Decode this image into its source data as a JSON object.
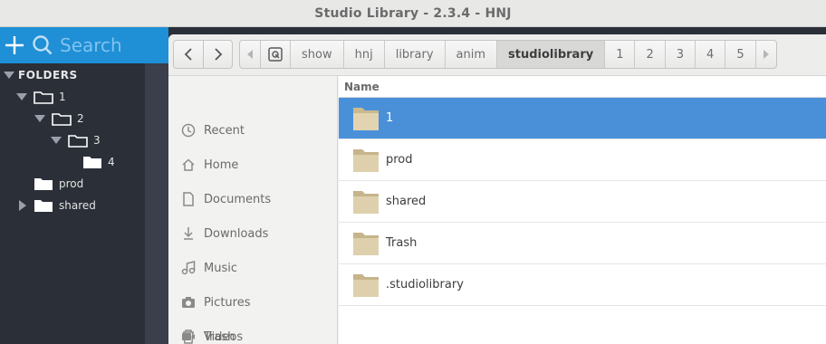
{
  "window": {
    "title": "Studio Library - 2.3.4 - HNJ"
  },
  "library": {
    "search_label": "Search",
    "folders_header": "FOLDERS",
    "tree": [
      {
        "label": "1",
        "level": 1,
        "expanded": true
      },
      {
        "label": "2",
        "level": 2,
        "expanded": true
      },
      {
        "label": "3",
        "level": 3,
        "expanded": true
      },
      {
        "label": "4",
        "level": 4,
        "expanded": false
      },
      {
        "label": "prod",
        "level": 1,
        "expanded": false
      },
      {
        "label": "shared",
        "level": 1,
        "expanded": false
      }
    ]
  },
  "dialog": {
    "breadcrumbs": [
      "show",
      "hnj",
      "library",
      "anim",
      "studiolibrary",
      "1",
      "2",
      "3",
      "4",
      "5"
    ],
    "active_crumb": "studiolibrary",
    "places": [
      {
        "label": "Recent",
        "icon": "clock-icon"
      },
      {
        "label": "Home",
        "icon": "home-icon"
      },
      {
        "label": "Documents",
        "icon": "document-icon"
      },
      {
        "label": "Downloads",
        "icon": "download-icon"
      },
      {
        "label": "Music",
        "icon": "music-icon"
      },
      {
        "label": "Pictures",
        "icon": "camera-icon"
      },
      {
        "label": "Videos",
        "icon": "video-icon"
      },
      {
        "label": "Trash",
        "icon": "trash-icon"
      }
    ],
    "column_name": "Name",
    "files": [
      {
        "name": "1",
        "selected": true
      },
      {
        "name": "prod",
        "selected": false
      },
      {
        "name": "shared",
        "selected": false
      },
      {
        "name": "Trash",
        "selected": false
      },
      {
        "name": ".studiolibrary",
        "selected": false
      }
    ]
  },
  "colors": {
    "accent": "#1f8fd6",
    "selection": "#4a90d9",
    "dark_panel": "#2b2f38",
    "folder": "#d9c9a8"
  }
}
